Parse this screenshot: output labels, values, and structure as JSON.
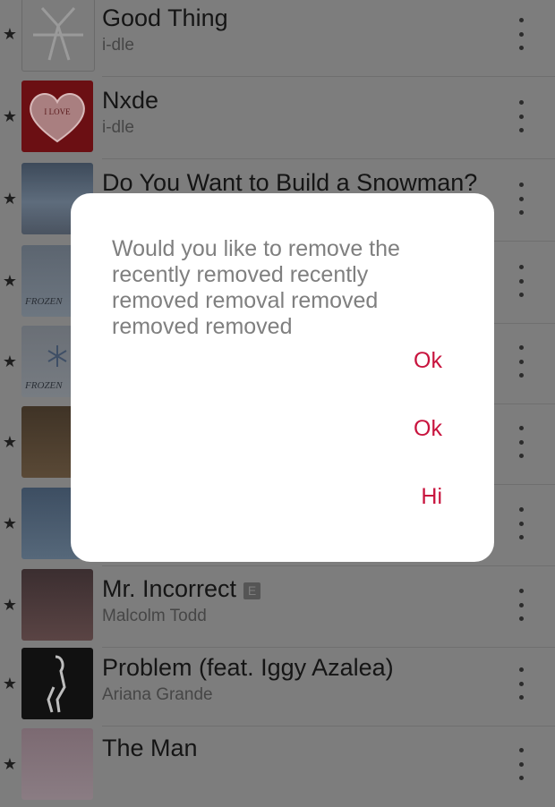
{
  "songs": [
    {
      "title": "Good Thing",
      "artist": "i-dle",
      "starred": true,
      "artwork": "good-thing-cover"
    },
    {
      "title": "Nxde",
      "artist": "i-dle",
      "starred": true,
      "artwork": "nxde-heart-cover",
      "artwork_text": "I LOVE"
    },
    {
      "title": "Do You Want to Build a Snowman?",
      "artist": "",
      "starred": true,
      "artwork": "frozen-cover"
    },
    {
      "title": "",
      "artist": "",
      "starred": true,
      "artwork": "frozen-cover",
      "artwork_text": "FROZEN"
    },
    {
      "title": "",
      "artist": "",
      "starred": true,
      "artwork": "frozen-cover",
      "artwork_text": "FROZEN"
    },
    {
      "title": "",
      "artist": "",
      "starred": true,
      "artwork": "album-cover"
    },
    {
      "title": "",
      "artist": "",
      "starred": true,
      "artwork": "frozen-cover"
    },
    {
      "title": "Mr. Incorrect",
      "artist": "Malcolm Todd",
      "starred": true,
      "explicit": "E",
      "artwork": "mr-incorrect-cover"
    },
    {
      "title": "Problem (feat. Iggy Azalea)",
      "artist": "Ariana Grande",
      "starred": true,
      "artwork": "problem-cover"
    },
    {
      "title": "The Man",
      "artist": "",
      "starred": true,
      "artwork": "the-man-cover"
    }
  ],
  "icons": {
    "star": "star-icon",
    "more": "more-vertical-icon"
  },
  "dialog": {
    "message": "Would you like to remove the recently removed recently removed removal removed removed removed",
    "buttons": [
      "Ok",
      "Ok",
      "Hi"
    ]
  },
  "colors": {
    "accent": "#c8143e",
    "dialog_bg": "#ffffff",
    "dimmed_bg": "#7d7d7d"
  }
}
